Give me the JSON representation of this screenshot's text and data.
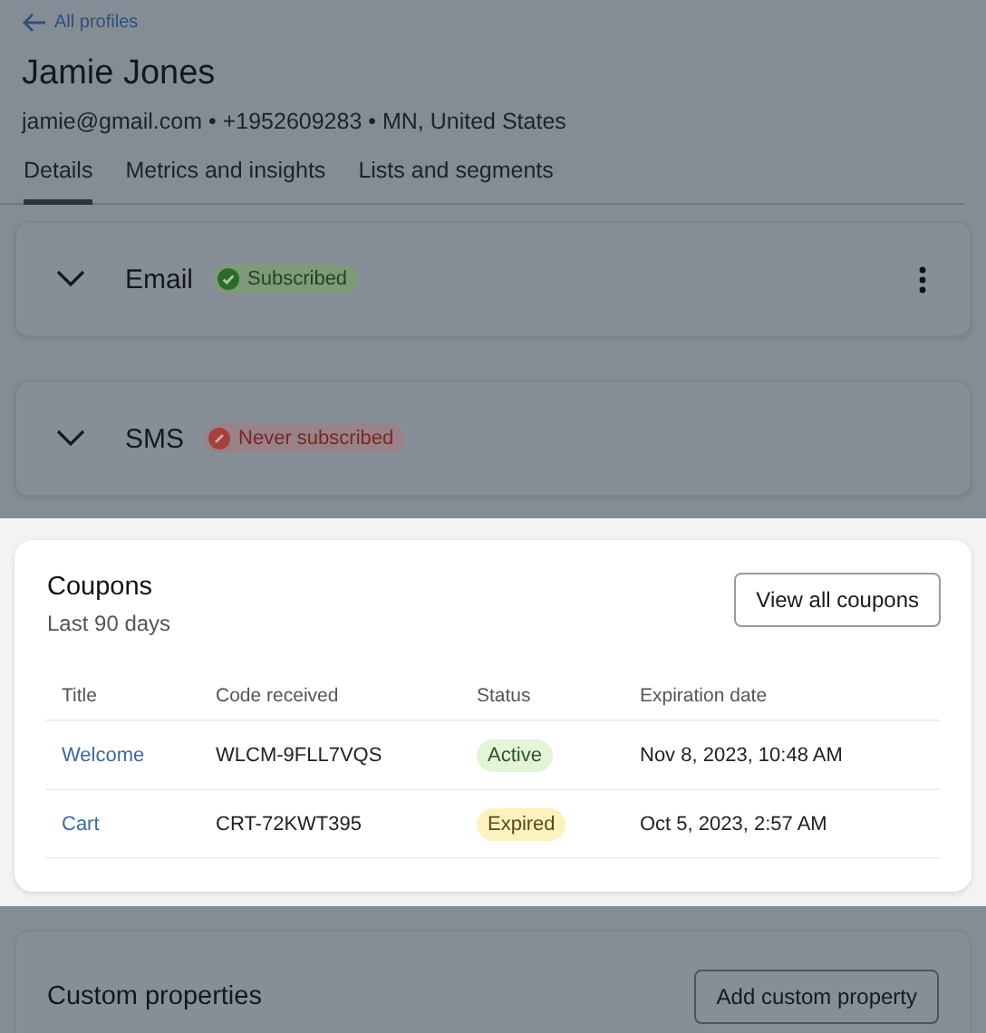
{
  "back_link": "All profiles",
  "profile": {
    "name": "Jamie Jones",
    "contact": "jamie@gmail.com • +1952609283 • MN, United States"
  },
  "tabs": [
    {
      "label": "Details",
      "selected": true
    },
    {
      "label": "Metrics and insights",
      "selected": false
    },
    {
      "label": "Lists and segments",
      "selected": false
    }
  ],
  "channels": [
    {
      "name": "Email",
      "status": "Subscribed",
      "kind": "subscribed",
      "expanded": false,
      "menu": true
    },
    {
      "name": "SMS",
      "status": "Never subscribed",
      "kind": "never",
      "expanded": false,
      "menu": false
    }
  ],
  "coupons": {
    "title": "Coupons",
    "subtitle": "Last 90 days",
    "button": "View all coupons",
    "columns": [
      "Title",
      "Code received",
      "Status",
      "Expiration date"
    ],
    "rows": [
      {
        "title": "Welcome",
        "code": "WLCM-9FLL7VQS",
        "status": "Active",
        "kind": "active",
        "expires": "Nov 8, 2023, 10:48 AM"
      },
      {
        "title": "Cart",
        "code": "CRT-72KWT395",
        "status": "Expired",
        "kind": "expired",
        "expires": "Oct 5, 2023, 2:57 AM"
      }
    ]
  },
  "custom_properties": {
    "title": "Custom properties",
    "button": "Add custom property"
  }
}
